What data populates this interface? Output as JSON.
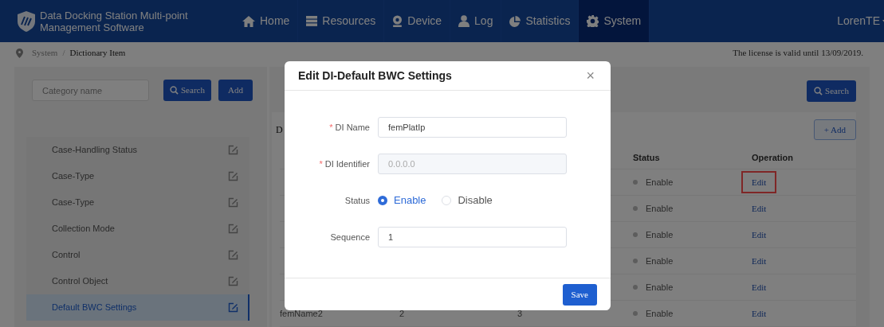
{
  "header": {
    "title_lines": [
      "Data Docking Station Multi-point",
      "Management Software"
    ],
    "nav": [
      {
        "label": "Home",
        "selected": false
      },
      {
        "label": "Resources",
        "selected": false
      },
      {
        "label": "Device",
        "selected": false
      },
      {
        "label": "Log",
        "selected": false
      },
      {
        "label": "Statistics",
        "selected": false
      },
      {
        "label": "System",
        "selected": true
      }
    ],
    "user": "LorenTE"
  },
  "breadcrumb": {
    "items": [
      "System",
      "Dictionary Item"
    ],
    "separator": "/"
  },
  "license": "The license is valid until 13/09/2019.",
  "sidebar": {
    "search": {
      "placeholder": "Category name"
    },
    "search_button": "Search",
    "add_button": "Add",
    "items": [
      {
        "label": "Case-Handling Status",
        "selected": false
      },
      {
        "label": "Case-Type",
        "selected": false
      },
      {
        "label": "Case-Type",
        "selected": false
      },
      {
        "label": "Collection Mode",
        "selected": false
      },
      {
        "label": "Control",
        "selected": false
      },
      {
        "label": "Control Object",
        "selected": false
      },
      {
        "label": "Default BWC Settings",
        "selected": true
      }
    ]
  },
  "main": {
    "search_button": "Search",
    "title": "D",
    "add_button": "+ Add",
    "table": {
      "columns": [
        "Status",
        "Operation"
      ],
      "rows": [
        {
          "status": "Enable",
          "operation": "Edit",
          "highlighted": true
        },
        {
          "status": "Enable",
          "operation": "Edit",
          "highlighted": false
        },
        {
          "status": "Enable",
          "operation": "Edit",
          "highlighted": false
        },
        {
          "status": "Enable",
          "operation": "Edit",
          "highlighted": false
        },
        {
          "status": "Enable",
          "operation": "Edit",
          "highlighted": false
        },
        {
          "column_1": "femName2",
          "column_2": "2",
          "column_3": "3",
          "status": "Enable",
          "operation": "Edit",
          "highlighted": false
        }
      ]
    }
  },
  "dialog": {
    "title": "Edit DI-Default BWC Settings",
    "close": "×",
    "required_mark": "*",
    "fields": [
      {
        "kind": "text",
        "label": "DI Name",
        "required": true,
        "value": "femPlatIp",
        "disabled": false
      },
      {
        "kind": "text",
        "label": "DI Identifier",
        "required": true,
        "value": "0.0.0.0",
        "disabled": true
      },
      {
        "kind": "radio",
        "label": "Status",
        "required": false,
        "options": [
          {
            "label": "Enable",
            "selected": true
          },
          {
            "label": "Disable",
            "selected": false
          }
        ]
      },
      {
        "kind": "text",
        "label": "Sequence",
        "required": false,
        "value": "1",
        "disabled": false
      }
    ],
    "save_button": "Save"
  }
}
